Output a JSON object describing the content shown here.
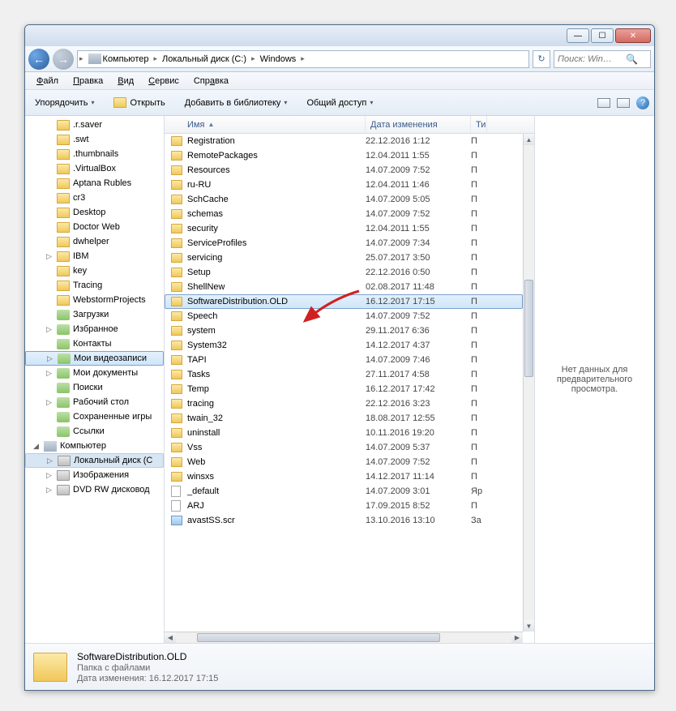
{
  "titlebar": {
    "min": "—",
    "max": "☐",
    "close": "✕"
  },
  "path": {
    "seg1": "Компьютер",
    "seg2": "Локальный диск (C:)",
    "seg3": "Windows"
  },
  "search": {
    "placeholder": "Поиск: Win…"
  },
  "menu": {
    "file": "Файл",
    "file_u": "Ф",
    "edit": "Правка",
    "edit_u": "П",
    "view": "Вид",
    "view_u": "В",
    "tools": "Сервис",
    "tools_u": "С",
    "help": "Справка",
    "help_u": "а"
  },
  "toolbar": {
    "organize": "Упорядочить",
    "open": "Открыть",
    "addlib": "Добавить в библиотеку",
    "share": "Общий доступ"
  },
  "cols": {
    "name": "Имя",
    "date": "Дата изменения",
    "type": "Ти"
  },
  "tree": [
    {
      "l": 2,
      "t": ".r.saver",
      "ic": "f"
    },
    {
      "l": 2,
      "t": ".swt",
      "ic": "f"
    },
    {
      "l": 2,
      "t": ".thumbnails",
      "ic": "f"
    },
    {
      "l": 2,
      "t": ".VirtualBox",
      "ic": "f"
    },
    {
      "l": 2,
      "t": "Aptana Rubles",
      "ic": "f"
    },
    {
      "l": 2,
      "t": "cr3",
      "ic": "f"
    },
    {
      "l": 2,
      "t": "Desktop",
      "ic": "f"
    },
    {
      "l": 2,
      "t": "Doctor Web",
      "ic": "f"
    },
    {
      "l": 2,
      "t": "dwhelper",
      "ic": "f"
    },
    {
      "l": 2,
      "t": "IBM",
      "ic": "f",
      "exp": "▷"
    },
    {
      "l": 2,
      "t": "key",
      "ic": "f"
    },
    {
      "l": 2,
      "t": "Tracing",
      "ic": "f"
    },
    {
      "l": 2,
      "t": "WebstormProjects",
      "ic": "f"
    },
    {
      "l": 2,
      "t": "Загрузки",
      "ic": "l"
    },
    {
      "l": 2,
      "t": "Избранное",
      "ic": "l",
      "exp": "▷"
    },
    {
      "l": 2,
      "t": "Контакты",
      "ic": "l"
    },
    {
      "l": 2,
      "t": "Мои видеозаписи",
      "ic": "l",
      "exp": "▷",
      "sel": true
    },
    {
      "l": 2,
      "t": "Мои документы",
      "ic": "l",
      "exp": "▷"
    },
    {
      "l": 2,
      "t": "Поиски",
      "ic": "l"
    },
    {
      "l": 2,
      "t": "Рабочий стол",
      "ic": "l",
      "exp": "▷"
    },
    {
      "l": 2,
      "t": "Сохраненные игры",
      "ic": "l"
    },
    {
      "l": 2,
      "t": "Ссылки",
      "ic": "l"
    },
    {
      "l": 1,
      "t": "Компьютер",
      "ic": "c",
      "exp": "◢"
    },
    {
      "l": 2,
      "t": "Локальный диск (C",
      "ic": "d",
      "exp": "▷",
      "sel2": true
    },
    {
      "l": 2,
      "t": "Изображения",
      "ic": "d",
      "exp": "▷"
    },
    {
      "l": 2,
      "t": "DVD RW дисковод",
      "ic": "d",
      "exp": "▷"
    }
  ],
  "files": [
    {
      "n": "Registration",
      "d": "22.12.2016 1:12",
      "t": "П",
      "ic": "f"
    },
    {
      "n": "RemotePackages",
      "d": "12.04.2011 1:55",
      "t": "П",
      "ic": "f"
    },
    {
      "n": "Resources",
      "d": "14.07.2009 7:52",
      "t": "П",
      "ic": "f"
    },
    {
      "n": "ru-RU",
      "d": "12.04.2011 1:46",
      "t": "П",
      "ic": "f"
    },
    {
      "n": "SchCache",
      "d": "14.07.2009 5:05",
      "t": "П",
      "ic": "f"
    },
    {
      "n": "schemas",
      "d": "14.07.2009 7:52",
      "t": "П",
      "ic": "f"
    },
    {
      "n": "security",
      "d": "12.04.2011 1:55",
      "t": "П",
      "ic": "f"
    },
    {
      "n": "ServiceProfiles",
      "d": "14.07.2009 7:34",
      "t": "П",
      "ic": "f"
    },
    {
      "n": "servicing",
      "d": "25.07.2017 3:50",
      "t": "П",
      "ic": "f"
    },
    {
      "n": "Setup",
      "d": "22.12.2016 0:50",
      "t": "П",
      "ic": "f"
    },
    {
      "n": "ShellNew",
      "d": "02.08.2017 11:48",
      "t": "П",
      "ic": "f"
    },
    {
      "n": "SoftwareDistribution.OLD",
      "d": "16.12.2017 17:15",
      "t": "П",
      "ic": "f",
      "sel": true
    },
    {
      "n": "Speech",
      "d": "14.07.2009 7:52",
      "t": "П",
      "ic": "f"
    },
    {
      "n": "system",
      "d": "29.11.2017 6:36",
      "t": "П",
      "ic": "f"
    },
    {
      "n": "System32",
      "d": "14.12.2017 4:37",
      "t": "П",
      "ic": "f"
    },
    {
      "n": "TAPI",
      "d": "14.07.2009 7:46",
      "t": "П",
      "ic": "f"
    },
    {
      "n": "Tasks",
      "d": "27.11.2017 4:58",
      "t": "П",
      "ic": "f"
    },
    {
      "n": "Temp",
      "d": "16.12.2017 17:42",
      "t": "П",
      "ic": "f"
    },
    {
      "n": "tracing",
      "d": "22.12.2016 3:23",
      "t": "П",
      "ic": "f"
    },
    {
      "n": "twain_32",
      "d": "18.08.2017 12:55",
      "t": "П",
      "ic": "f"
    },
    {
      "n": "uninstall",
      "d": "10.11.2016 19:20",
      "t": "П",
      "ic": "f"
    },
    {
      "n": "Vss",
      "d": "14.07.2009 5:37",
      "t": "П",
      "ic": "f"
    },
    {
      "n": "Web",
      "d": "14.07.2009 7:52",
      "t": "П",
      "ic": "f"
    },
    {
      "n": "winsxs",
      "d": "14.12.2017 11:14",
      "t": "П",
      "ic": "f"
    },
    {
      "n": "_default",
      "d": "14.07.2009 3:01",
      "t": "Яр",
      "ic": "t"
    },
    {
      "n": "ARJ",
      "d": "17.09.2015 8:52",
      "t": "П",
      "ic": "t"
    },
    {
      "n": "avastSS.scr",
      "d": "13.10.2016 13:10",
      "t": "За",
      "ic": "s"
    }
  ],
  "preview": {
    "text": "Нет данных для предварительного просмотра."
  },
  "details": {
    "name": "SoftwareDistribution.OLD",
    "type": "Папка с файлами",
    "modlabel": "Дата изменения:",
    "moddate": "16.12.2017 17:15"
  }
}
